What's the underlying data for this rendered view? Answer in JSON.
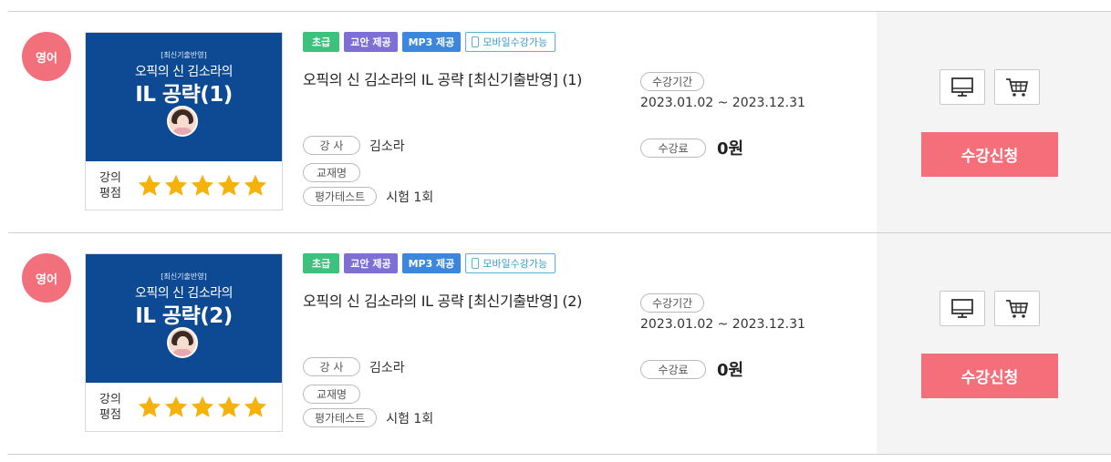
{
  "courses": [
    {
      "category": "영어",
      "cover": {
        "tag": "[최신기출반영]",
        "subtitle": "오픽의 신 김소라의",
        "title": "IL 공략(1)"
      },
      "rating": {
        "label_1": "강의",
        "label_2": "평점",
        "stars": 5,
        "max": 5,
        "color": "#f5b20a"
      },
      "tags": {
        "level": "초급",
        "text": "교안 제공",
        "mp3": "MP3 제공",
        "mobile": "모바일수강가능"
      },
      "title": "오픽의 신 김소라의 IL 공략 [최신기출반영] (1)",
      "teacher_label": "강 사",
      "teacher": "김소라",
      "textbook_label": "교재명",
      "test_label": "평가테스트",
      "test_value": "시험 1회",
      "period_label": "수강기간",
      "period": "2023.01.02 ~ 2023.12.31",
      "fee_label": "수강료",
      "fee": "0원",
      "icons": {
        "view": "monitor-icon",
        "cart": "cart-icon"
      },
      "apply_label": "수강신청"
    },
    {
      "category": "영어",
      "cover": {
        "tag": "[최신기출반영]",
        "subtitle": "오픽의 신 김소라의",
        "title": "IL 공략(2)"
      },
      "rating": {
        "label_1": "강의",
        "label_2": "평점",
        "stars": 5,
        "max": 5,
        "color": "#f5b20a"
      },
      "tags": {
        "level": "초급",
        "text": "교안 제공",
        "mp3": "MP3 제공",
        "mobile": "모바일수강가능"
      },
      "title": "오픽의 신 김소라의 IL 공략 [최신기출반영] (2)",
      "teacher_label": "강 사",
      "teacher": "김소라",
      "textbook_label": "교재명",
      "test_label": "평가테스트",
      "test_value": "시험 1회",
      "period_label": "수강기간",
      "period": "2023.01.02 ~ 2023.12.31",
      "fee_label": "수강료",
      "fee": "0원",
      "icons": {
        "view": "monitor-icon",
        "cart": "cart-icon"
      },
      "apply_label": "수강신청"
    }
  ],
  "colors": {
    "category_badge": "#f2707b",
    "cover_bg": "#0e4a93",
    "level_tag": "#3cc27c",
    "text_tag": "#7d6fd6",
    "mp3_tag": "#3b87dd",
    "apply_button": "#f46f7a",
    "side_panel": "#f4f4f4"
  }
}
